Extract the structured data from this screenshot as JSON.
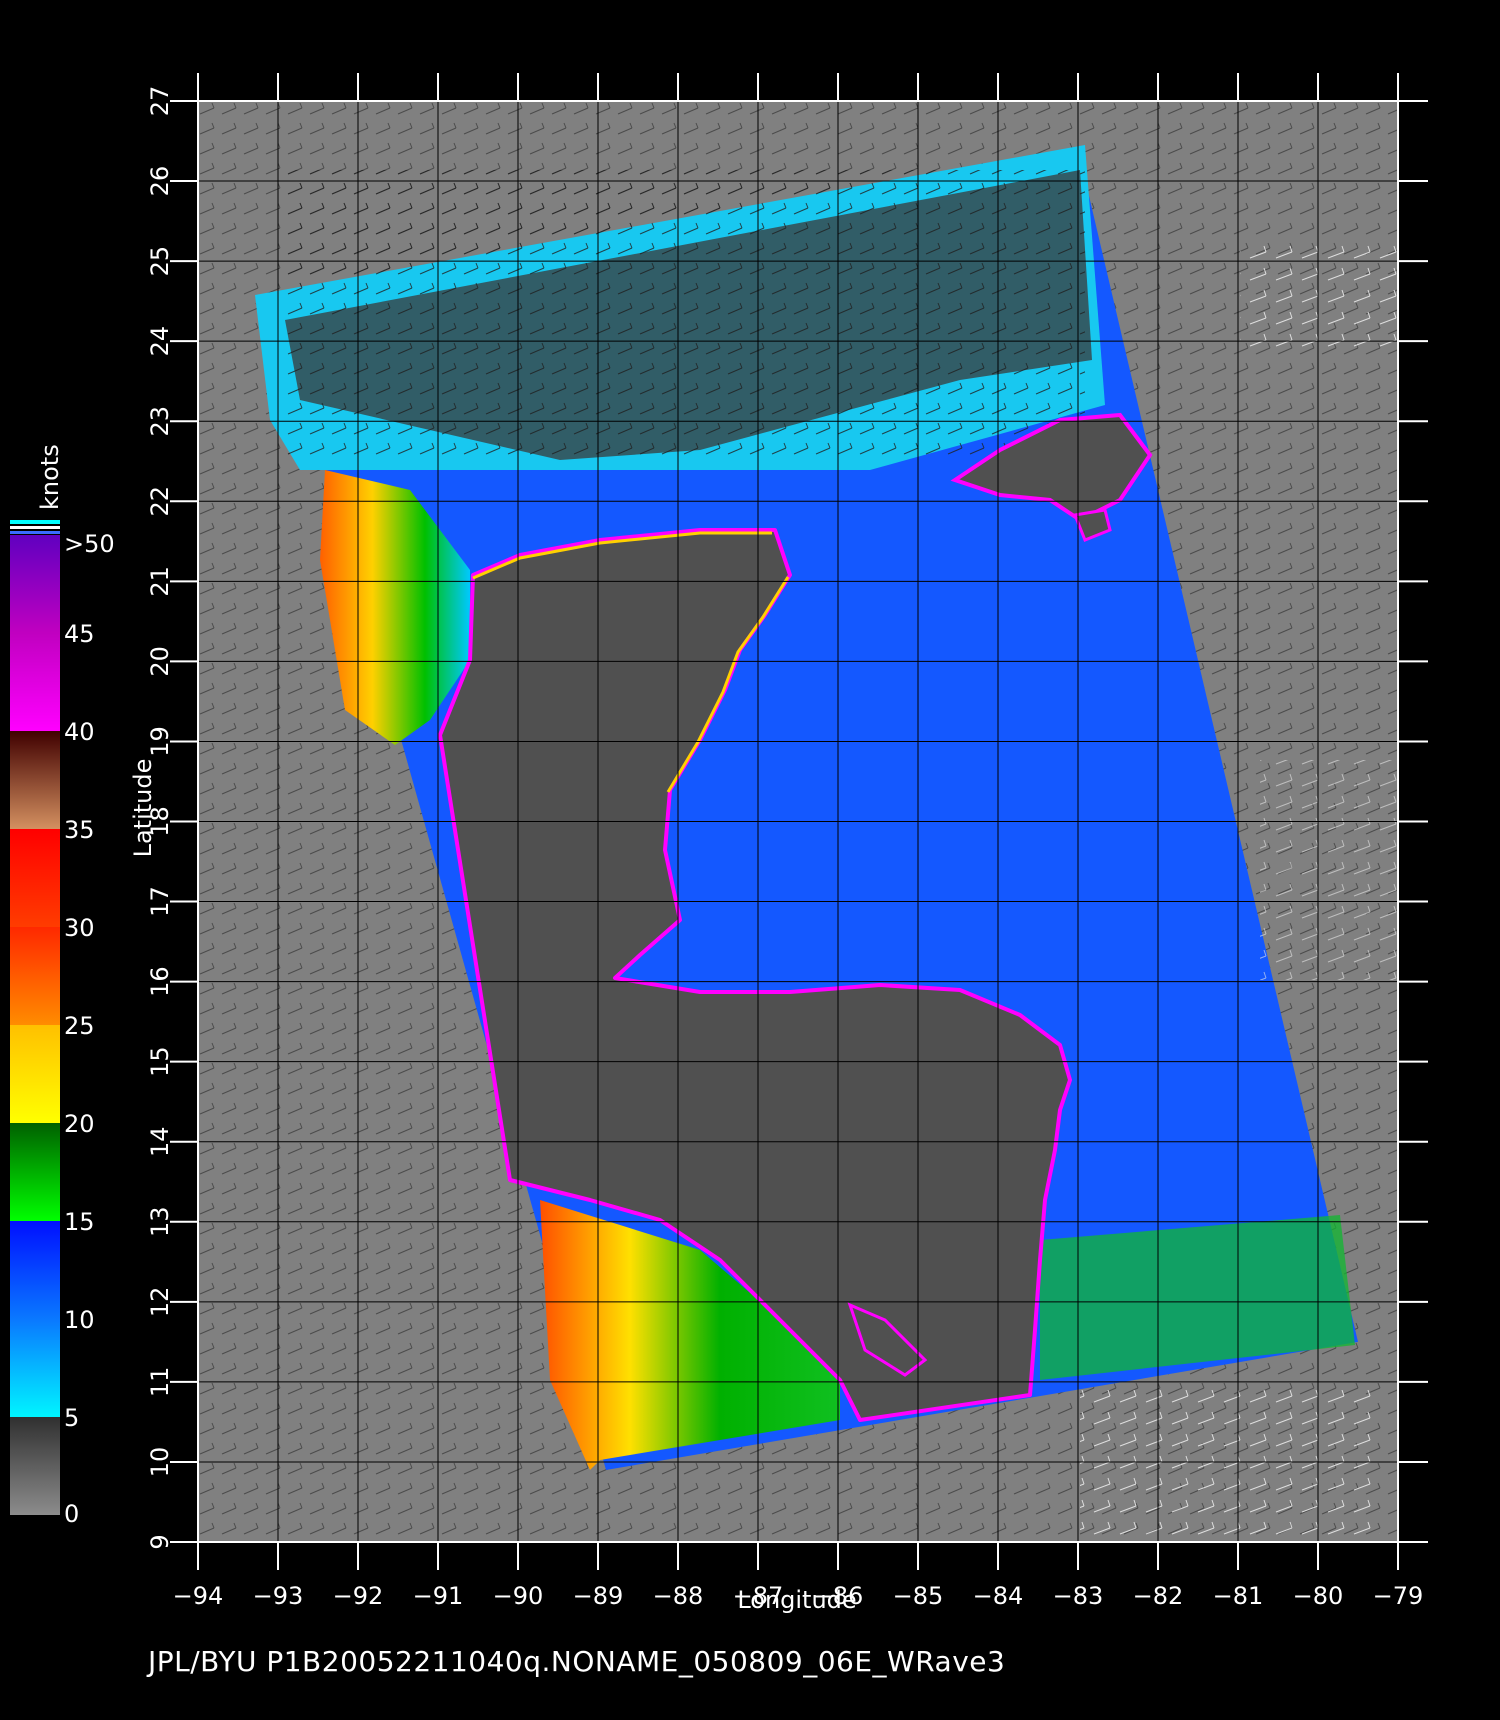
{
  "map": {
    "x_axis": {
      "label": "Longitude",
      "ticks": [
        "−94",
        "−93",
        "−92",
        "−91",
        "−90",
        "−89",
        "−88",
        "−87",
        "−86",
        "−85",
        "−84",
        "−83",
        "−82",
        "−81",
        "−80",
        "−79"
      ]
    },
    "y_axis": {
      "label": "Latitude",
      "ticks": [
        "9",
        "10",
        "11",
        "12",
        "13",
        "14",
        "15",
        "16",
        "17",
        "18",
        "19",
        "20",
        "21",
        "22",
        "23",
        "24",
        "25",
        "26",
        "27"
      ]
    },
    "extent": {
      "lon": [
        -94,
        -79
      ],
      "lat": [
        9,
        27
      ]
    },
    "grid": true,
    "swath_corners_lonlat": [
      [
        -93.0,
        24.5
      ],
      [
        -83.0,
        26.4
      ],
      [
        -79.5,
        11.5
      ],
      [
        -88.9,
        9.9
      ]
    ],
    "land_color": "#505050",
    "background_color": "#808080"
  },
  "legend": {
    "unit": "knots",
    "ticks": [
      "0",
      "5",
      "10",
      "15",
      "20",
      "25",
      "30",
      "35",
      "40",
      "45",
      ">50"
    ],
    "bands": [
      {
        "from": 0,
        "to": 5,
        "top": "#303030",
        "bottom": "#8c8c8c"
      },
      {
        "from": 5,
        "to": 10,
        "top": "#0a78ff",
        "bottom": "#00f5ff"
      },
      {
        "from": 10,
        "to": 15,
        "top": "#0010ff",
        "bottom": "#0a78ff"
      },
      {
        "from": 15,
        "to": 20,
        "top": "#006000",
        "bottom": "#00ff00"
      },
      {
        "from": 20,
        "to": 25,
        "top": "#ffc000",
        "bottom": "#ffff00"
      },
      {
        "from": 25,
        "to": 30,
        "top": "#ff2800",
        "bottom": "#ff8c00"
      },
      {
        "from": 30,
        "to": 35,
        "top": "#ff0000",
        "bottom": "#ff3c00"
      },
      {
        "from": 35,
        "to": 40,
        "top": "#400000",
        "bottom": "#d49060"
      },
      {
        "from": 40,
        "to": 45,
        "top": "#c000c0",
        "bottom": "#ff00ff"
      },
      {
        "from": 45,
        "to": 50,
        "top": "#6000c0",
        "bottom": "#c000c0"
      }
    ]
  },
  "caption": "JPL/BYU  P1B20052211040q.NONAME_050809_06E_WRave3"
}
